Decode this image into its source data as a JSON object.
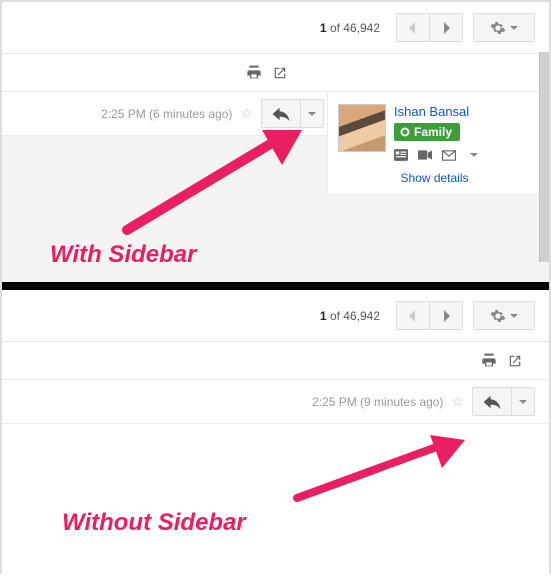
{
  "top": {
    "counter_current": "1",
    "counter_sep": " of ",
    "counter_total": "46,942"
  },
  "msg1": {
    "time": "2:25 PM (6 minutes ago)"
  },
  "contact": {
    "name": "Ishan Bansal",
    "circle": "Family",
    "details": "Show details"
  },
  "msg2": {
    "time": "2:25 PM (9 minutes ago)"
  },
  "annot": {
    "a": "With Sidebar",
    "b": "Without Sidebar"
  }
}
